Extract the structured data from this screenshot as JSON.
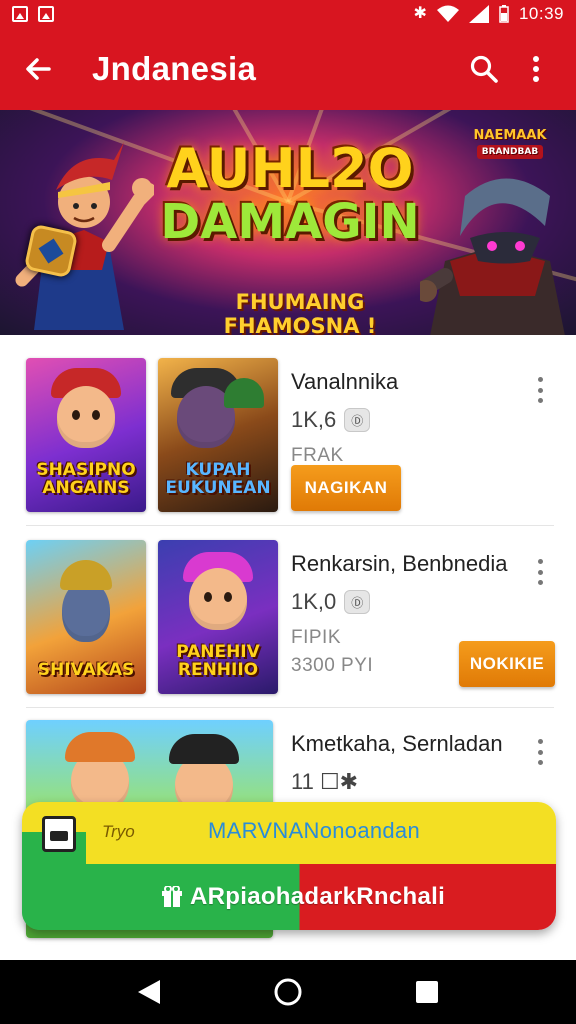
{
  "status_bar": {
    "time": "10:39",
    "icons": [
      "image-icon",
      "image-icon",
      "bluetooth-icon",
      "wifi-icon",
      "signal-icon",
      "battery-icon"
    ]
  },
  "app_bar": {
    "title": "Jndanesia",
    "icons": [
      "back-arrow-icon",
      "search-icon",
      "more-vert-icon"
    ],
    "color": "#d81520"
  },
  "banner": {
    "title_line1": "AUHL2O",
    "title_line2": "DAMAGIN",
    "subtitle": "FHUMAING FHAMOSNA !",
    "badge_line1": "NAEMAAK",
    "badge_line2": "BRANDBAB"
  },
  "apps": [
    {
      "name": "Vanalnnika",
      "rating": "1K,6",
      "rating_chip": "Ⓓ",
      "meta": "FRAK",
      "meta2": "",
      "button": "NAGIKAN",
      "thumb1_caption": "SHASIPNO ANGAINS",
      "thumb2_caption": "KUPAH EUKUNEAN"
    },
    {
      "name": "Renkarsin, Benbnedia",
      "rating": "1K,0",
      "rating_chip": "Ⓓ",
      "meta": "FIPIK",
      "meta2": "3300 PYI",
      "button": "NOKIKIE",
      "thumb1_caption": "SHIVAKAS",
      "thumb2_caption": "PANEHIV RENHIIO"
    },
    {
      "name": "Kmetkaha, Sernladan",
      "rating": "11 ☐✱",
      "rating_chip": "",
      "meta": "",
      "meta2": "",
      "button": "",
      "thumb1_caption": "",
      "thumb2_caption": ""
    }
  ],
  "promo": {
    "small_label": "Tryo",
    "line1": "MARVNANonoandan",
    "line2": "ARpiaohadarkRnchali",
    "colors": {
      "yellow": "#f3df23",
      "green": "#29b34a",
      "red": "#d91c20"
    }
  },
  "nav_bar": {
    "icons": [
      "back-triangle-icon",
      "home-circle-icon",
      "recents-square-icon"
    ]
  }
}
